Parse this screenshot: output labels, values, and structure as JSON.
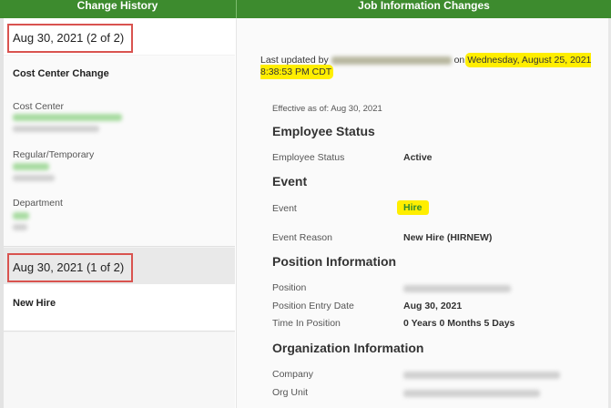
{
  "header": {
    "left_title": "Change History",
    "right_title": "Job Information Changes"
  },
  "history": {
    "entries": [
      {
        "date_label": "Aug 30, 2021 (2 of 2)",
        "title": "Cost Center Change",
        "fields": [
          {
            "label": "Cost Center"
          },
          {
            "label": "Regular/Temporary"
          },
          {
            "label": "Department"
          }
        ]
      },
      {
        "date_label": "Aug 30, 2021 (1 of 2)",
        "title": "New Hire"
      }
    ]
  },
  "details": {
    "last_updated_prefix": "Last updated by",
    "last_updated_on": "on",
    "last_updated_datetime": "Wednesday, August 25, 2021 8:38:53 PM CDT",
    "effective": "Effective as of: Aug 30, 2021",
    "sections": {
      "employee_status": {
        "title": "Employee Status",
        "rows": [
          {
            "label": "Employee Status",
            "value": "Active"
          }
        ]
      },
      "event": {
        "title": "Event",
        "rows": [
          {
            "label": "Event",
            "value": "Hire"
          },
          {
            "label": "Event Reason",
            "value": "New Hire (HIRNEW)"
          }
        ]
      },
      "position": {
        "title": "Position Information",
        "rows": [
          {
            "label": "Position"
          },
          {
            "label": "Position Entry Date",
            "value": "Aug 30, 2021"
          },
          {
            "label": "Time In Position",
            "value": "0 Years 0 Months 5 Days"
          }
        ]
      },
      "organization": {
        "title": "Organization Information",
        "rows": [
          {
            "label": "Company"
          },
          {
            "label": "Org Unit"
          }
        ]
      }
    }
  },
  "colors": {
    "header_green": "#3d8b2e",
    "highlight_yellow": "#ffee00",
    "annotation_red": "#d9534f",
    "hire_text_green": "#2f8a2f"
  }
}
